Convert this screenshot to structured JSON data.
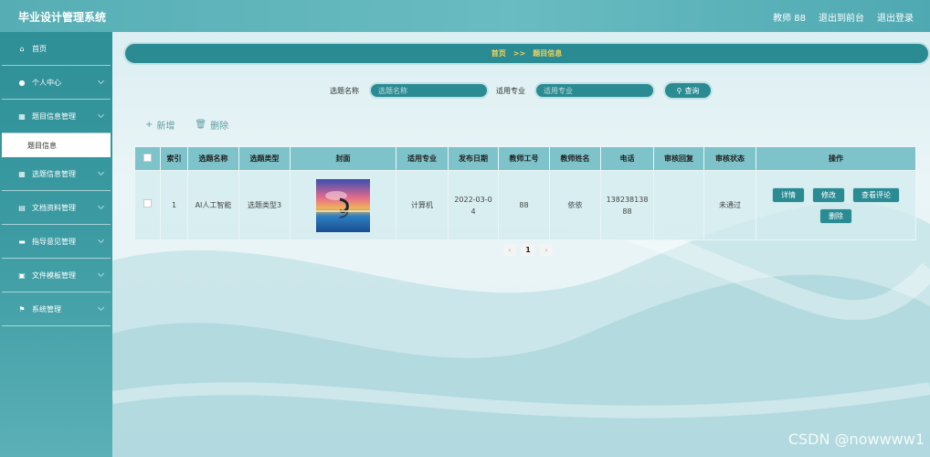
{
  "app": {
    "title": "毕业设计管理系统"
  },
  "top_right": {
    "user": "教师 88",
    "back_link": "退出到前台",
    "logout": "退出登录"
  },
  "sidebar": {
    "items": [
      {
        "label": "首页",
        "icon": "home-icon"
      },
      {
        "label": "个人中心",
        "icon": "user-icon"
      },
      {
        "label": "题目信息管理",
        "icon": "grid-icon"
      },
      {
        "label": "选题信息管理",
        "icon": "grid-icon"
      },
      {
        "label": "文档资料管理",
        "icon": "document-icon"
      },
      {
        "label": "指导意见管理",
        "icon": "comment-icon"
      },
      {
        "label": "文件模板管理",
        "icon": "briefcase-icon"
      },
      {
        "label": "系统管理",
        "icon": "flag-icon"
      }
    ],
    "sub_item": "题目信息"
  },
  "breadcrumb": {
    "home": "首页",
    "sep": ">>",
    "current": "题目信息"
  },
  "search": {
    "label1": "选题名称",
    "placeholder1": "选题名称",
    "label2": "适用专业",
    "placeholder2": "适用专业",
    "button": "查询"
  },
  "actions": {
    "add": "新增",
    "delete": "删除"
  },
  "table": {
    "headers": [
      "索引",
      "选题名称",
      "选题类型",
      "封面",
      "适用专业",
      "发布日期",
      "教师工号",
      "教师姓名",
      "电话",
      "审核回复",
      "审核状态",
      "操作"
    ],
    "rows": [
      {
        "index": "1",
        "name": "AI人工智能",
        "type": "选题类型3",
        "major": "计算机",
        "date": "2022-03-04",
        "teacher_id": "88",
        "teacher_name": "依依",
        "phone": "13823813888",
        "reply": "",
        "status": "未通过",
        "ops": {
          "detail": "详情",
          "edit": "修改",
          "comments": "查看评论",
          "delete": "删除"
        }
      }
    ]
  },
  "pager": {
    "prev": "‹",
    "current": "1",
    "next": "›"
  },
  "watermark": "CSDN @nowwww1",
  "colors": {
    "accent": "#2a8b93",
    "header_bg": "#69bcc1",
    "breadcrumb_text": "#f5d35a"
  }
}
